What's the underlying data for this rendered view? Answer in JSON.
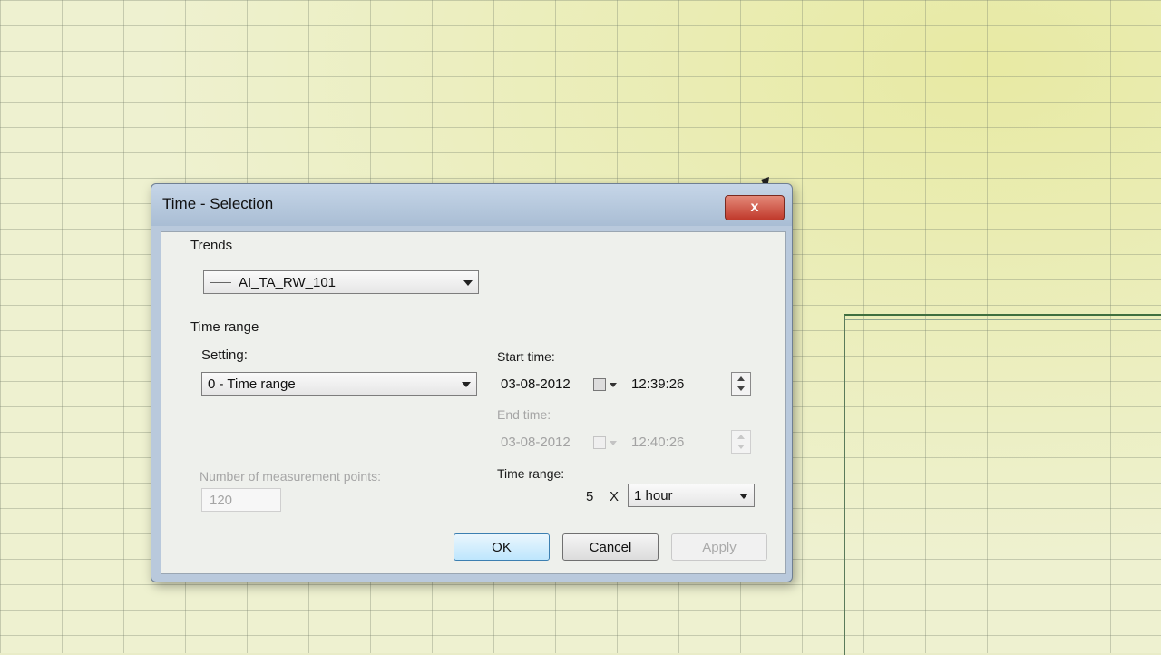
{
  "dialog": {
    "title": "Time - Selection",
    "close_label": "x"
  },
  "trends": {
    "group_label": "Trends",
    "selected": "AI_TA_RW_101"
  },
  "time_range": {
    "group_label": "Time range",
    "setting_label": "Setting:",
    "setting_value": "0 - Time range",
    "start_time_label": "Start time:",
    "start_date": "03-08-2012",
    "start_time": "12:39:26",
    "end_time_label": "End time:",
    "end_date": "03-08-2012",
    "end_time": "12:40:26",
    "range_label": "Time range:",
    "range_count": "5",
    "range_multiplier": "X",
    "range_unit": "1 hour",
    "points_label": "Number of measurement points:",
    "points_value": "120"
  },
  "buttons": {
    "ok": "OK",
    "cancel": "Cancel",
    "apply": "Apply"
  }
}
